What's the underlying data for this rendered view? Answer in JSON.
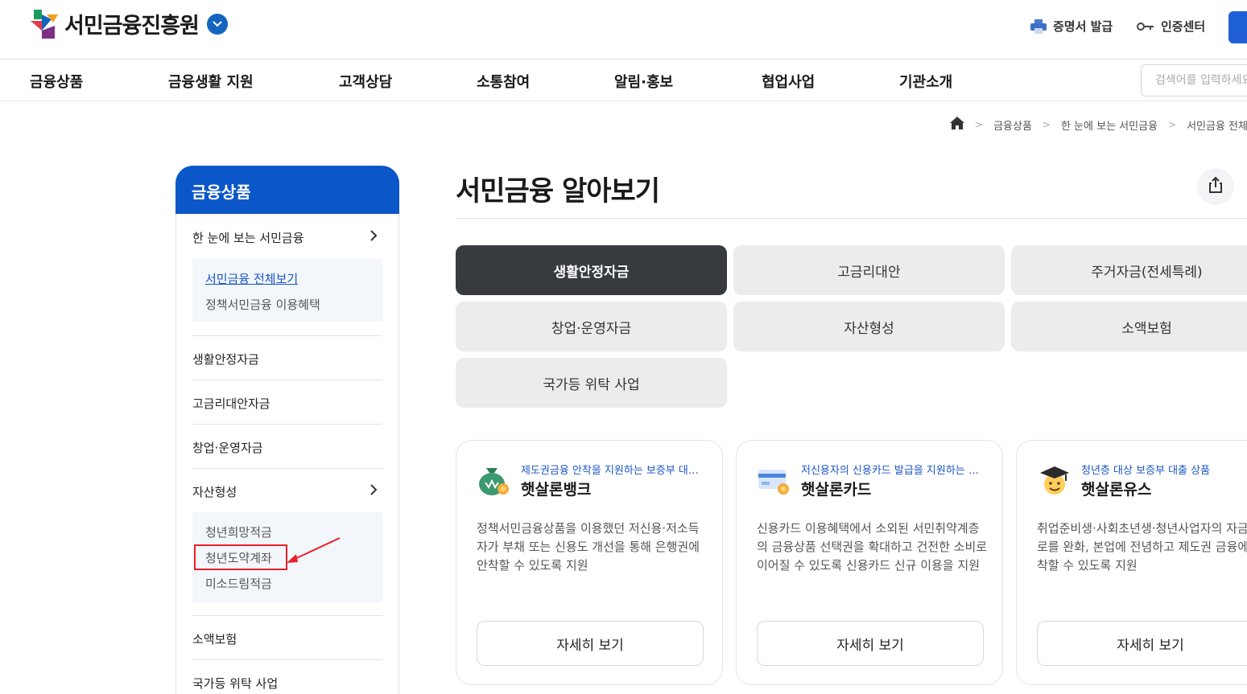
{
  "header": {
    "logo_text": "서민금융진흥원",
    "certificate_label": "증명서 발급",
    "auth_label": "인증센터"
  },
  "gnb": {
    "items": [
      "금융상품",
      "금융생활 지원",
      "고객상담",
      "소통참여",
      "알림·홍보",
      "협업사업",
      "기관소개"
    ],
    "search_placeholder": "검색어를 입력하세요"
  },
  "breadcrumb": [
    "금융상품",
    "한 눈에 보는 서민금융",
    "서민금융 전체보기"
  ],
  "sidebar": {
    "title": "금융상품",
    "items": [
      {
        "label": "한 눈에 보는 서민금융"
      },
      {
        "label": "생활안정자금"
      },
      {
        "label": "고금리대안자금"
      },
      {
        "label": "창업·운영자금"
      },
      {
        "label": "자산형성"
      },
      {
        "label": "소액보험"
      },
      {
        "label": "국가등 위탁 사업"
      }
    ],
    "sub_overview": [
      "서민금융 전체보기",
      "정책서민금융 이용혜택"
    ],
    "sub_assets": [
      "청년희망적금",
      "청년도약계좌",
      "미소드림적금"
    ]
  },
  "main": {
    "title": "서민금융 알아보기",
    "categories": [
      "생활안정자금",
      "고금리대안",
      "주거자금(전세특례)",
      "창업·운영자금",
      "자산형성",
      "소액보험",
      "국가등 위탁 사업"
    ],
    "cards": [
      {
        "tag": "제도권금융 안착을 지원하는 보증부 대출 상품",
        "name": "햇살론뱅크",
        "desc": "정책서민금융상품을 이용했던 저신용·저소득자가 부채 또는 신용도 개선을 통해 은행권에 안착할 수 있도록 지원",
        "button": "자세히 보기",
        "icon": "money-bag-icon"
      },
      {
        "tag": "저신용자의 신용카드 발급을 지원하는 상품",
        "name": "햇살론카드",
        "desc": "신용카드 이용혜택에서 소외된 서민취약계층의 금융상품 선택권을 확대하고 건전한 소비로 이어질 수 있도록 신용카드 신규 이용을 지원",
        "button": "자세히 보기",
        "icon": "credit-card-icon"
      },
      {
        "tag": "청년층 대상 보증부 대출 상품",
        "name": "햇살론유스",
        "desc": "취업준비생·사회초년생·청년사업자의 자금애로를 완화, 본업에 전념하고 제도권 금융에 안착할 수 있도록 지원",
        "button": "자세히 보기",
        "icon": "graduation-cap-icon"
      }
    ]
  },
  "colors": {
    "primary": "#0b57c9",
    "active_category": "#373a3f",
    "highlight": "#e8202a"
  }
}
